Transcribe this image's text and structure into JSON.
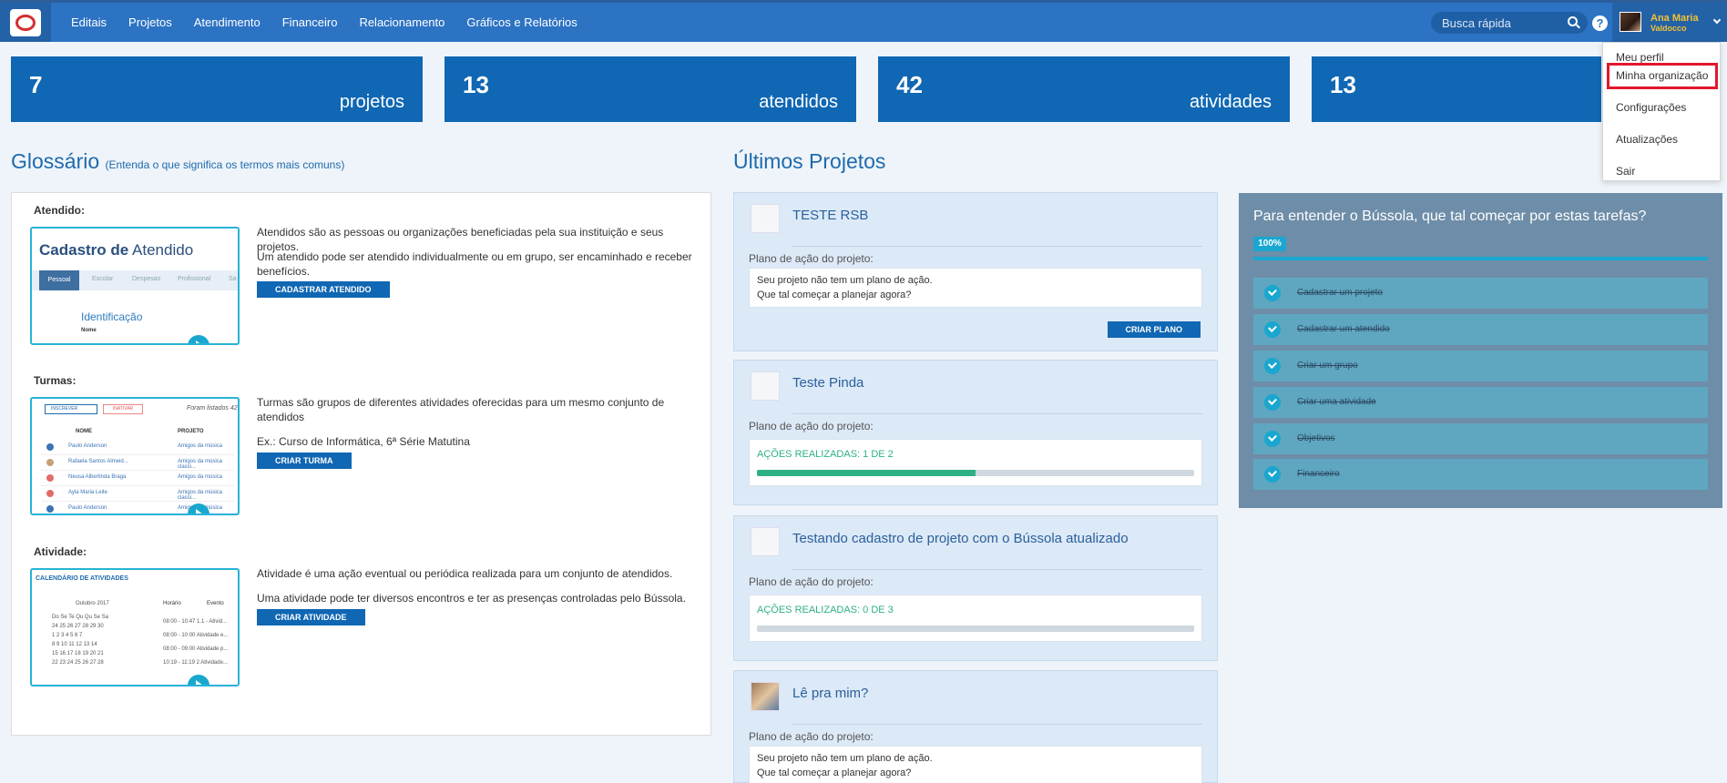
{
  "nav": {
    "items": [
      "Editais",
      "Projetos",
      "Atendimento",
      "Financeiro",
      "Relacionamento",
      "Gráficos e Relatórios"
    ],
    "search_placeholder": "Busca rápida",
    "help": "?",
    "user_first": "Ana Maria",
    "user_last": "Valdocco"
  },
  "dropdown": {
    "items": [
      "Meu perfil",
      "Minha organização",
      "Configurações",
      "Atualizações",
      "Sair"
    ],
    "highlighted": "Minha organização"
  },
  "stats": [
    {
      "num": "7",
      "label": "projetos"
    },
    {
      "num": "13",
      "label": "atendidos"
    },
    {
      "num": "42",
      "label": "atividades"
    },
    {
      "num": "13",
      "label": ""
    }
  ],
  "glossary": {
    "title": "Glossário",
    "subtitle": "(Entenda o que significa os termos mais comuns)",
    "sections": [
      {
        "heading": "Atendido:",
        "text1": "Atendidos são as pessoas ou organizações beneficiadas pela sua instituição e seus projetos.",
        "text2": "Um atendido pode ser atendido individualmente ou em grupo, ser encaminhado e receber benefícios.",
        "button": "CADASTRAR ATENDIDO",
        "thumb": {
          "title_bold": "Cadastro de",
          "title_rest": " Atendido",
          "tabs": [
            "Pessoal",
            "Escolar",
            "Despesas",
            "Profissional",
            "Sa"
          ],
          "sub": "Identificação",
          "small": "Nome"
        }
      },
      {
        "heading": "Turmas:",
        "text1": "Turmas são grupos de diferentes atividades oferecidas para um mesmo conjunto de atendidos",
        "text2": "Ex.: Curso de Informática, 6ª Série Matutina",
        "button": "CRIAR TURMA",
        "thumb": {
          "select": "INSCREVER",
          "tag": "INATIVAR",
          "count": "Foram listados 42",
          "col_nome": "NOME",
          "col_projeto": "PROJETO",
          "rows": [
            {
              "nome": "Paulo Anderson",
              "projeto": "Amigos da música"
            },
            {
              "nome": "Rafaela Santos Almeid...",
              "projeto": "Amigos da música classi..."
            },
            {
              "nome": "Neusa Albertinda Braga",
              "projeto": "Amigos da música"
            },
            {
              "nome": "Ayla Maria Leite",
              "projeto": "Amigos da música classi..."
            },
            {
              "nome": "Paulo Anderson",
              "projeto": "Amigos da música"
            }
          ]
        }
      },
      {
        "heading": "Atividade:",
        "text1": "Atividade é uma ação eventual ou periódica realizada para um conjunto de atendidos.",
        "text2": "Uma atividade pode ter diversos encontros e ter as presenças controladas pelo Bússola.",
        "button": "CRIAR ATIVIDADE",
        "thumb": {
          "title": "CALENDÁRIO DE ATIVIDADES",
          "month": "Outubro 2017",
          "days": "Do Se Te Qu Qu Se Sa",
          "weeks": [
            "24 25 26 27 28 29 30",
            "1 2 3 4 5 6 7",
            "8 9 10 11 12 13 14",
            "15 16 17 18 19 20 21",
            "22 23 24 25 26 27 28"
          ],
          "col_horario": "Horário",
          "col_evento": "Evento",
          "events": [
            "08:00 - 10:47   1.1 - Ativid...",
            "08:00 - 10:00   Atividade e...",
            "08:00 - 09:00   Atividade p...",
            "10:19 - 11:19   2 Atividade..."
          ]
        }
      }
    ]
  },
  "projects": {
    "title": "Últimos Projetos",
    "plan_label": "Plano de ação do projeto:",
    "cards": [
      {
        "name": "TESTE RSB",
        "empty_line1": "Seu projeto não tem um plano de ação.",
        "empty_line2": "Que tal começar a planejar agora?",
        "button": "CRIAR PLANO"
      },
      {
        "name": "Teste Pinda",
        "acoes": "AÇÕES REALIZADAS: 1 DE 2",
        "progress": 0.5
      },
      {
        "name": "Testando cadastro de projeto com o Bússola atualizado",
        "acoes": "AÇÕES REALIZADAS: 0 DE 3",
        "progress": 0
      },
      {
        "name": "Lê pra mim?",
        "empty_line1": "Seu projeto não tem um plano de ação.",
        "empty_line2": "Que tal começar a planejar agora?"
      }
    ]
  },
  "onboarding": {
    "title": "Para entender o Bússola, que tal começar por estas tarefas?",
    "percent": "100%",
    "progress": 1.0,
    "tasks": [
      "Cadastrar um projeto",
      "Cadastrar um atendido",
      "Criar um grupo",
      "Criar uma atividade",
      "Objetivos",
      "Financeiro"
    ]
  },
  "colors": {
    "nav": "#2c73c3",
    "tile": "#1067b3",
    "accent": "#1aa7cf",
    "success": "#2eb087",
    "highlight": "#e0182d",
    "user_name": "#f2c230"
  }
}
